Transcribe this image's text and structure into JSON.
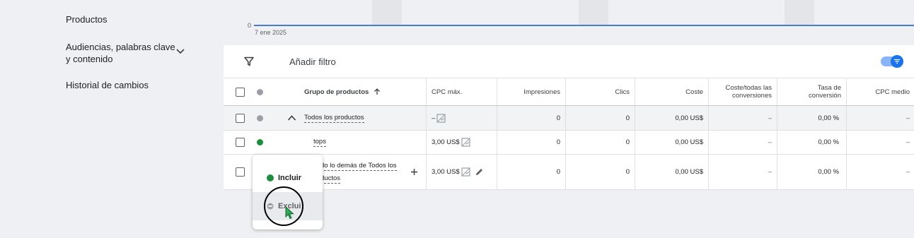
{
  "sidebar": {
    "items": [
      {
        "label": "Productos"
      },
      {
        "label": "Audiencias, palabras clave y contenido"
      },
      {
        "label": "Historial de cambios"
      }
    ]
  },
  "chart": {
    "y_zero": "0",
    "x_label": "7 ene 2025"
  },
  "toolbar": {
    "filter_label": "Añadir filtro"
  },
  "table": {
    "headers": {
      "product_group": "Grupo de productos",
      "max_cpc": "CPC máx.",
      "impressions": "Impresiones",
      "clicks": "Clics",
      "cost": "Coste",
      "cost_conv": "Coste/todas las conversiones",
      "conv_rate": "Tasa de conversión",
      "avg_cpc": "CPC medio"
    },
    "rows": [
      {
        "name": "Todos los productos",
        "max_cpc": "–",
        "impressions": "0",
        "clicks": "0",
        "cost": "0,00 US$",
        "cost_conv": "–",
        "conv_rate": "0,00 %",
        "avg_cpc": "–"
      },
      {
        "name": "tops",
        "max_cpc": "3,00 US$",
        "impressions": "0",
        "clicks": "0",
        "cost": "0,00 US$",
        "cost_conv": "–",
        "conv_rate": "0,00 %",
        "avg_cpc": "–"
      },
      {
        "name_line1": "do lo demás de Todos los",
        "name_line2": "ductos",
        "max_cpc": "3,00 US$",
        "impressions": "0",
        "clicks": "0",
        "cost": "0,00 US$",
        "cost_conv": "–",
        "conv_rate": "0,00 %",
        "avg_cpc": "–"
      }
    ]
  },
  "popup": {
    "include_label": "Incluir",
    "exclude_label": "Exclui"
  },
  "colors": {
    "accent": "#1a73e8",
    "status_green": "#1e8e3e",
    "status_grey": "#9aa0a6"
  }
}
